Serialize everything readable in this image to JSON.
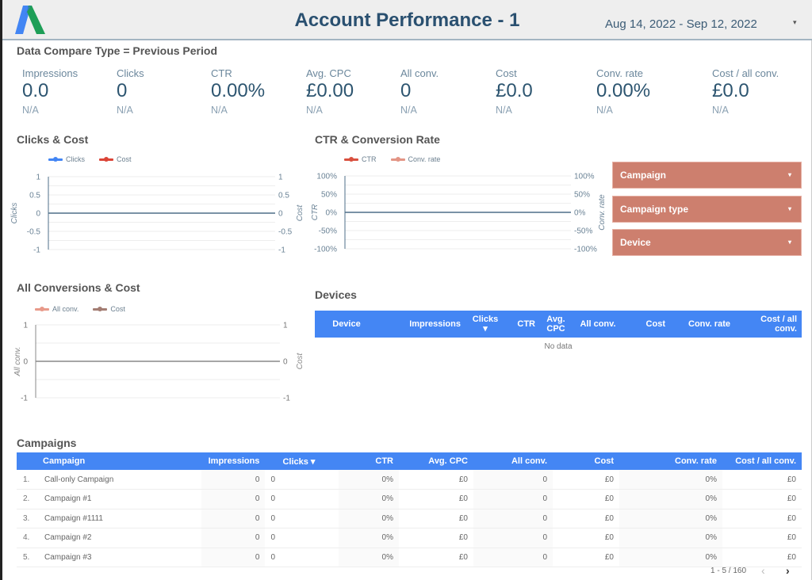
{
  "header": {
    "title": "Account Performance - 1",
    "date_range": "Aug 14, 2022 - Sep 12, 2022",
    "date_caret": "▾",
    "compare_type": "Data Compare Type = Previous Period"
  },
  "kpis": [
    {
      "label": "Impressions",
      "value": "0.0",
      "compare": "N/A"
    },
    {
      "label": "Clicks",
      "value": "0",
      "compare": "N/A"
    },
    {
      "label": "CTR",
      "value": "0.00%",
      "compare": "N/A"
    },
    {
      "label": "Avg. CPC",
      "value": "£0.00",
      "compare": "N/A"
    },
    {
      "label": "All conv.",
      "value": "0",
      "compare": "N/A"
    },
    {
      "label": "Cost",
      "value": "£0.0",
      "compare": "N/A"
    },
    {
      "label": "Conv. rate",
      "value": "0.00%",
      "compare": "N/A"
    },
    {
      "label": "Cost / all conv.",
      "value": "£0.0",
      "compare": "N/A"
    }
  ],
  "colors": {
    "accent_blue": "#4486f4",
    "filter_bg": "#cd7f6e",
    "title": "#2a5070"
  },
  "filters": [
    {
      "label": "Campaign",
      "caret": "▾"
    },
    {
      "label": "Campaign type",
      "caret": "▾"
    },
    {
      "label": "Device",
      "caret": "▾"
    }
  ],
  "chart_data": [
    {
      "type": "line",
      "title": "Clicks & Cost",
      "series": [
        {
          "name": "Clicks",
          "color": "#4285f4",
          "values": []
        },
        {
          "name": "Cost",
          "color": "#db4437",
          "values": []
        }
      ],
      "ylabel": "Clicks",
      "y2label": "Cost",
      "ylim": [
        -1,
        1
      ],
      "y2lim": [
        -1,
        1
      ],
      "yticks": [
        "1",
        "0.5",
        "0",
        "-0.5",
        "-1"
      ],
      "y2ticks": [
        "1",
        "0.5",
        "0",
        "-0.5",
        "-1"
      ],
      "grid": true,
      "legend": "top-left"
    },
    {
      "type": "line",
      "title": "CTR & Conversion Rate",
      "series": [
        {
          "name": "CTR",
          "color": "#d9503f",
          "values": []
        },
        {
          "name": "Conv. rate",
          "color": "#e39585",
          "values": []
        }
      ],
      "ylabel": "CTR",
      "y2label": "Conv. rate",
      "ylim": [
        -100,
        100
      ],
      "y2lim": [
        -100,
        100
      ],
      "yticks": [
        "100%",
        "50%",
        "0%",
        "-50%",
        "-100%"
      ],
      "y2ticks": [
        "100%",
        "50%",
        "0%",
        "-50%",
        "-100%"
      ],
      "grid": true,
      "legend": "top-left"
    },
    {
      "type": "line",
      "title": "All Conversions & Cost",
      "series": [
        {
          "name": "All conv.",
          "color": "#e89a8a",
          "values": []
        },
        {
          "name": "Cost",
          "color": "#a37d73",
          "values": []
        }
      ],
      "ylabel": "All conv.",
      "y2label": "Cost",
      "ylim": [
        -1,
        1
      ],
      "y2lim": [
        -1,
        1
      ],
      "yticks": [
        "1",
        "0",
        "-1"
      ],
      "y2ticks": [
        "1",
        "0",
        "-1"
      ],
      "grid": true,
      "legend": "top-left"
    }
  ],
  "devices": {
    "title": "Devices",
    "columns": [
      "Device",
      "Impressions",
      "Clicks ▾",
      "CTR",
      "Avg. CPC",
      "All conv.",
      "Cost",
      "Conv. rate",
      "Cost / all conv."
    ],
    "empty_text": "No data"
  },
  "campaigns": {
    "title": "Campaigns",
    "columns": [
      "Campaign",
      "Impressions",
      "Clicks ▾",
      "CTR",
      "Avg. CPC",
      "All conv.",
      "Cost",
      "Conv. rate",
      "Cost / all conv."
    ],
    "rows": [
      {
        "index": "1.",
        "name": "Call-only Campaign",
        "impressions": "0",
        "clicks": "0",
        "ctr": "0%",
        "avg_cpc": "£0",
        "all_conv": "0",
        "cost": "£0",
        "conv_rate": "0%",
        "cost_per_conv": "£0"
      },
      {
        "index": "2.",
        "name": "Campaign #1",
        "impressions": "0",
        "clicks": "0",
        "ctr": "0%",
        "avg_cpc": "£0",
        "all_conv": "0",
        "cost": "£0",
        "conv_rate": "0%",
        "cost_per_conv": "£0"
      },
      {
        "index": "3.",
        "name": "Campaign #1111",
        "impressions": "0",
        "clicks": "0",
        "ctr": "0%",
        "avg_cpc": "£0",
        "all_conv": "0",
        "cost": "£0",
        "conv_rate": "0%",
        "cost_per_conv": "£0"
      },
      {
        "index": "4.",
        "name": "Campaign #2",
        "impressions": "0",
        "clicks": "0",
        "ctr": "0%",
        "avg_cpc": "£0",
        "all_conv": "0",
        "cost": "£0",
        "conv_rate": "0%",
        "cost_per_conv": "£0"
      },
      {
        "index": "5.",
        "name": "Campaign #3",
        "impressions": "0",
        "clicks": "0",
        "ctr": "0%",
        "avg_cpc": "£0",
        "all_conv": "0",
        "cost": "£0",
        "conv_rate": "0%",
        "cost_per_conv": "£0"
      }
    ],
    "pagination": "1 - 5 / 160",
    "prev": "‹",
    "next": "›"
  }
}
